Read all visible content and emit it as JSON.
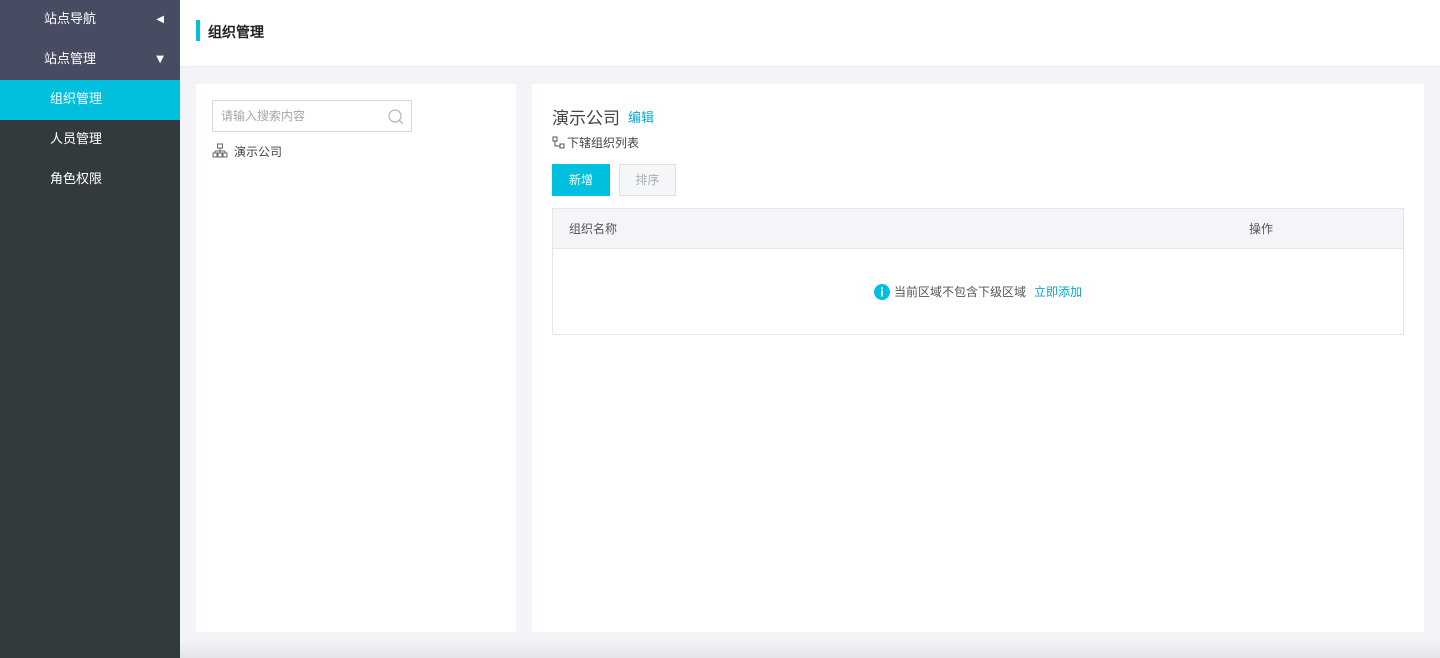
{
  "sidebar": {
    "groups": [
      {
        "label": "站点导航",
        "caret": "◀"
      },
      {
        "label": "站点管理",
        "caret": "▼"
      }
    ],
    "items": [
      {
        "label": "组织管理",
        "active": true
      },
      {
        "label": "人员管理"
      },
      {
        "label": "角色权限"
      }
    ]
  },
  "header": {
    "title": "组织管理"
  },
  "tree": {
    "search_placeholder": "请输入搜索内容",
    "root_label": "演示公司"
  },
  "detail": {
    "org_name": "演示公司",
    "edit_label": "编辑",
    "sub_list_label": "下辖组织列表",
    "add_button": "新增",
    "sort_button": "排序",
    "table": {
      "col_name": "组织名称",
      "col_op": "操作",
      "empty_text": "当前区域不包含下级区域",
      "empty_action": "立即添加"
    }
  },
  "colors": {
    "accent": "#00c0de",
    "link": "#0aa6d8",
    "sidebar": "#323a3e"
  }
}
